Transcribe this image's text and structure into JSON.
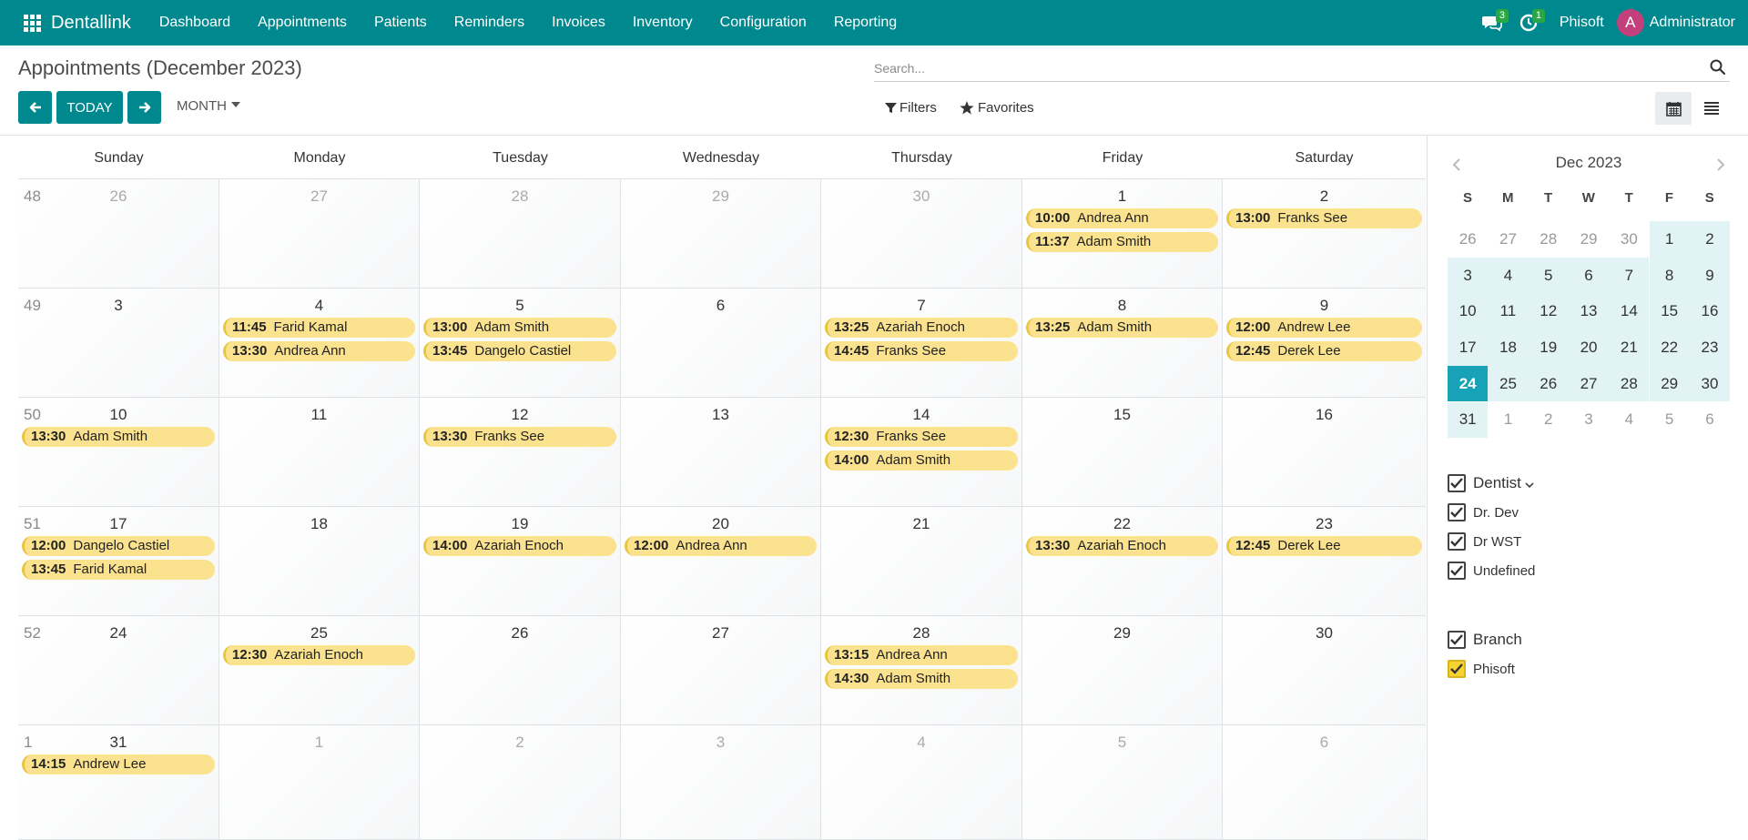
{
  "navbar": {
    "brand": "Dentallink",
    "menu": [
      "Dashboard",
      "Appointments",
      "Patients",
      "Reminders",
      "Invoices",
      "Inventory",
      "Configuration",
      "Reporting"
    ],
    "messages_count": "3",
    "activities_count": "1",
    "company": "Phisoft",
    "user_initial": "A",
    "user_name": "Administrator",
    "bg_color": "#00888f"
  },
  "control_panel": {
    "title": "Appointments (December 2023)",
    "search_placeholder": "Search...",
    "today_label": "TODAY",
    "scale_label": "MONTH",
    "filters_label": "Filters",
    "favorites_label": "Favorites"
  },
  "calendar": {
    "day_headers": [
      "Sunday",
      "Monday",
      "Tuesday",
      "Wednesday",
      "Thursday",
      "Friday",
      "Saturday"
    ],
    "weeks": [
      {
        "num": "48",
        "days": [
          {
            "n": "26",
            "o": true,
            "ev": []
          },
          {
            "n": "27",
            "o": true,
            "ev": []
          },
          {
            "n": "28",
            "o": true,
            "ev": []
          },
          {
            "n": "29",
            "o": true,
            "ev": []
          },
          {
            "n": "30",
            "o": true,
            "ev": []
          },
          {
            "n": "1",
            "o": false,
            "ev": [
              {
                "t": "10:00",
                "p": "Andrea Ann"
              },
              {
                "t": "11:37",
                "p": "Adam Smith"
              }
            ]
          },
          {
            "n": "2",
            "o": false,
            "ev": [
              {
                "t": "13:00",
                "p": "Franks See"
              }
            ]
          }
        ]
      },
      {
        "num": "49",
        "days": [
          {
            "n": "3",
            "o": false,
            "ev": []
          },
          {
            "n": "4",
            "o": false,
            "ev": [
              {
                "t": "11:45",
                "p": "Farid Kamal"
              },
              {
                "t": "13:30",
                "p": "Andrea Ann"
              }
            ]
          },
          {
            "n": "5",
            "o": false,
            "ev": [
              {
                "t": "13:00",
                "p": "Adam Smith"
              },
              {
                "t": "13:45",
                "p": "Dangelo Castiel"
              }
            ]
          },
          {
            "n": "6",
            "o": false,
            "ev": []
          },
          {
            "n": "7",
            "o": false,
            "ev": [
              {
                "t": "13:25",
                "p": "Azariah Enoch"
              },
              {
                "t": "14:45",
                "p": "Franks See"
              }
            ]
          },
          {
            "n": "8",
            "o": false,
            "ev": [
              {
                "t": "13:25",
                "p": "Adam Smith"
              }
            ]
          },
          {
            "n": "9",
            "o": false,
            "ev": [
              {
                "t": "12:00",
                "p": "Andrew Lee"
              },
              {
                "t": "12:45",
                "p": "Derek Lee"
              }
            ]
          }
        ]
      },
      {
        "num": "50",
        "days": [
          {
            "n": "10",
            "o": false,
            "ev": [
              {
                "t": "13:30",
                "p": "Adam Smith"
              }
            ]
          },
          {
            "n": "11",
            "o": false,
            "ev": []
          },
          {
            "n": "12",
            "o": false,
            "ev": [
              {
                "t": "13:30",
                "p": "Franks See"
              }
            ]
          },
          {
            "n": "13",
            "o": false,
            "ev": []
          },
          {
            "n": "14",
            "o": false,
            "ev": [
              {
                "t": "12:30",
                "p": "Franks See"
              },
              {
                "t": "14:00",
                "p": "Adam Smith"
              }
            ]
          },
          {
            "n": "15",
            "o": false,
            "ev": []
          },
          {
            "n": "16",
            "o": false,
            "ev": []
          }
        ]
      },
      {
        "num": "51",
        "days": [
          {
            "n": "17",
            "o": false,
            "ev": [
              {
                "t": "12:00",
                "p": "Dangelo Castiel"
              },
              {
                "t": "13:45",
                "p": "Farid Kamal"
              }
            ]
          },
          {
            "n": "18",
            "o": false,
            "ev": []
          },
          {
            "n": "19",
            "o": false,
            "ev": [
              {
                "t": "14:00",
                "p": "Azariah Enoch"
              }
            ]
          },
          {
            "n": "20",
            "o": false,
            "ev": [
              {
                "t": "12:00",
                "p": "Andrea Ann"
              }
            ]
          },
          {
            "n": "21",
            "o": false,
            "ev": []
          },
          {
            "n": "22",
            "o": false,
            "ev": [
              {
                "t": "13:30",
                "p": "Azariah Enoch"
              }
            ]
          },
          {
            "n": "23",
            "o": false,
            "ev": [
              {
                "t": "12:45",
                "p": "Derek Lee"
              }
            ]
          }
        ]
      },
      {
        "num": "52",
        "days": [
          {
            "n": "24",
            "o": false,
            "ev": []
          },
          {
            "n": "25",
            "o": false,
            "ev": [
              {
                "t": "12:30",
                "p": "Azariah Enoch"
              }
            ]
          },
          {
            "n": "26",
            "o": false,
            "ev": []
          },
          {
            "n": "27",
            "o": false,
            "ev": []
          },
          {
            "n": "28",
            "o": false,
            "ev": [
              {
                "t": "13:15",
                "p": "Andrea Ann"
              },
              {
                "t": "14:30",
                "p": "Adam Smith"
              }
            ]
          },
          {
            "n": "29",
            "o": false,
            "ev": []
          },
          {
            "n": "30",
            "o": false,
            "ev": []
          }
        ]
      },
      {
        "num": "1",
        "days": [
          {
            "n": "31",
            "o": false,
            "ev": [
              {
                "t": "14:15",
                "p": "Andrew Lee"
              }
            ]
          },
          {
            "n": "1",
            "o": true,
            "ev": []
          },
          {
            "n": "2",
            "o": true,
            "ev": []
          },
          {
            "n": "3",
            "o": true,
            "ev": []
          },
          {
            "n": "4",
            "o": true,
            "ev": []
          },
          {
            "n": "5",
            "o": true,
            "ev": []
          },
          {
            "n": "6",
            "o": true,
            "ev": []
          }
        ]
      }
    ],
    "event_color": "#fbe28f"
  },
  "mini_calendar": {
    "title": "Dec 2023",
    "dow": [
      "S",
      "M",
      "T",
      "W",
      "T",
      "F",
      "S"
    ],
    "rows": [
      [
        "26",
        "27",
        "28",
        "29",
        "30",
        "1",
        "2"
      ],
      [
        "3",
        "4",
        "5",
        "6",
        "7",
        "8",
        "9"
      ],
      [
        "10",
        "11",
        "12",
        "13",
        "14",
        "15",
        "16"
      ],
      [
        "17",
        "18",
        "19",
        "20",
        "21",
        "22",
        "23"
      ],
      [
        "24",
        "25",
        "26",
        "27",
        "28",
        "29",
        "30"
      ],
      [
        "31",
        "1",
        "2",
        "3",
        "4",
        "5",
        "6"
      ]
    ],
    "today": "24"
  },
  "filters": {
    "dentist": {
      "title": "Dentist",
      "items": [
        "Dr. Dev",
        "Dr WST",
        "Undefined"
      ]
    },
    "branch": {
      "title": "Branch",
      "items": [
        "Phisoft"
      ]
    }
  }
}
